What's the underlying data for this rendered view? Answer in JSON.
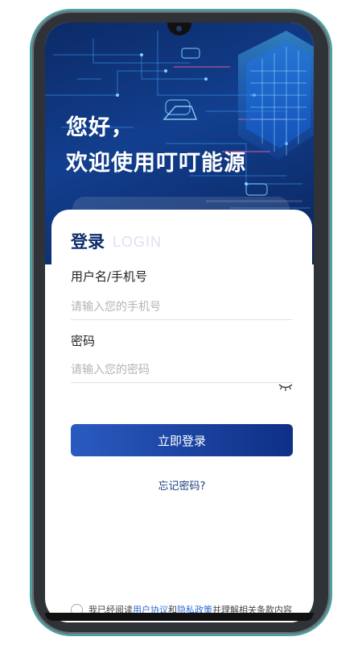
{
  "hero": {
    "greeting_line1": "您好，",
    "greeting_line2": "欢迎使用叮叮能源"
  },
  "login": {
    "title": "登录",
    "title_en": "LOGIN",
    "username_label": "用户名/手机号",
    "username_placeholder": "请输入您的手机号",
    "password_label": "密码",
    "password_placeholder": "请输入您的密码",
    "submit_label": "立即登录",
    "forgot_label": "忘记密码?"
  },
  "agreement": {
    "prefix": "我已经阅读",
    "user_agreement": "用户协议",
    "conj": "和",
    "privacy_policy": "隐私政策",
    "suffix": "并理解相关条款内容"
  },
  "colors": {
    "brand_dark": "#0f2d6b",
    "button_start": "#2a5bc0",
    "button_end": "#0e2f86",
    "link": "#2f6bd8"
  }
}
